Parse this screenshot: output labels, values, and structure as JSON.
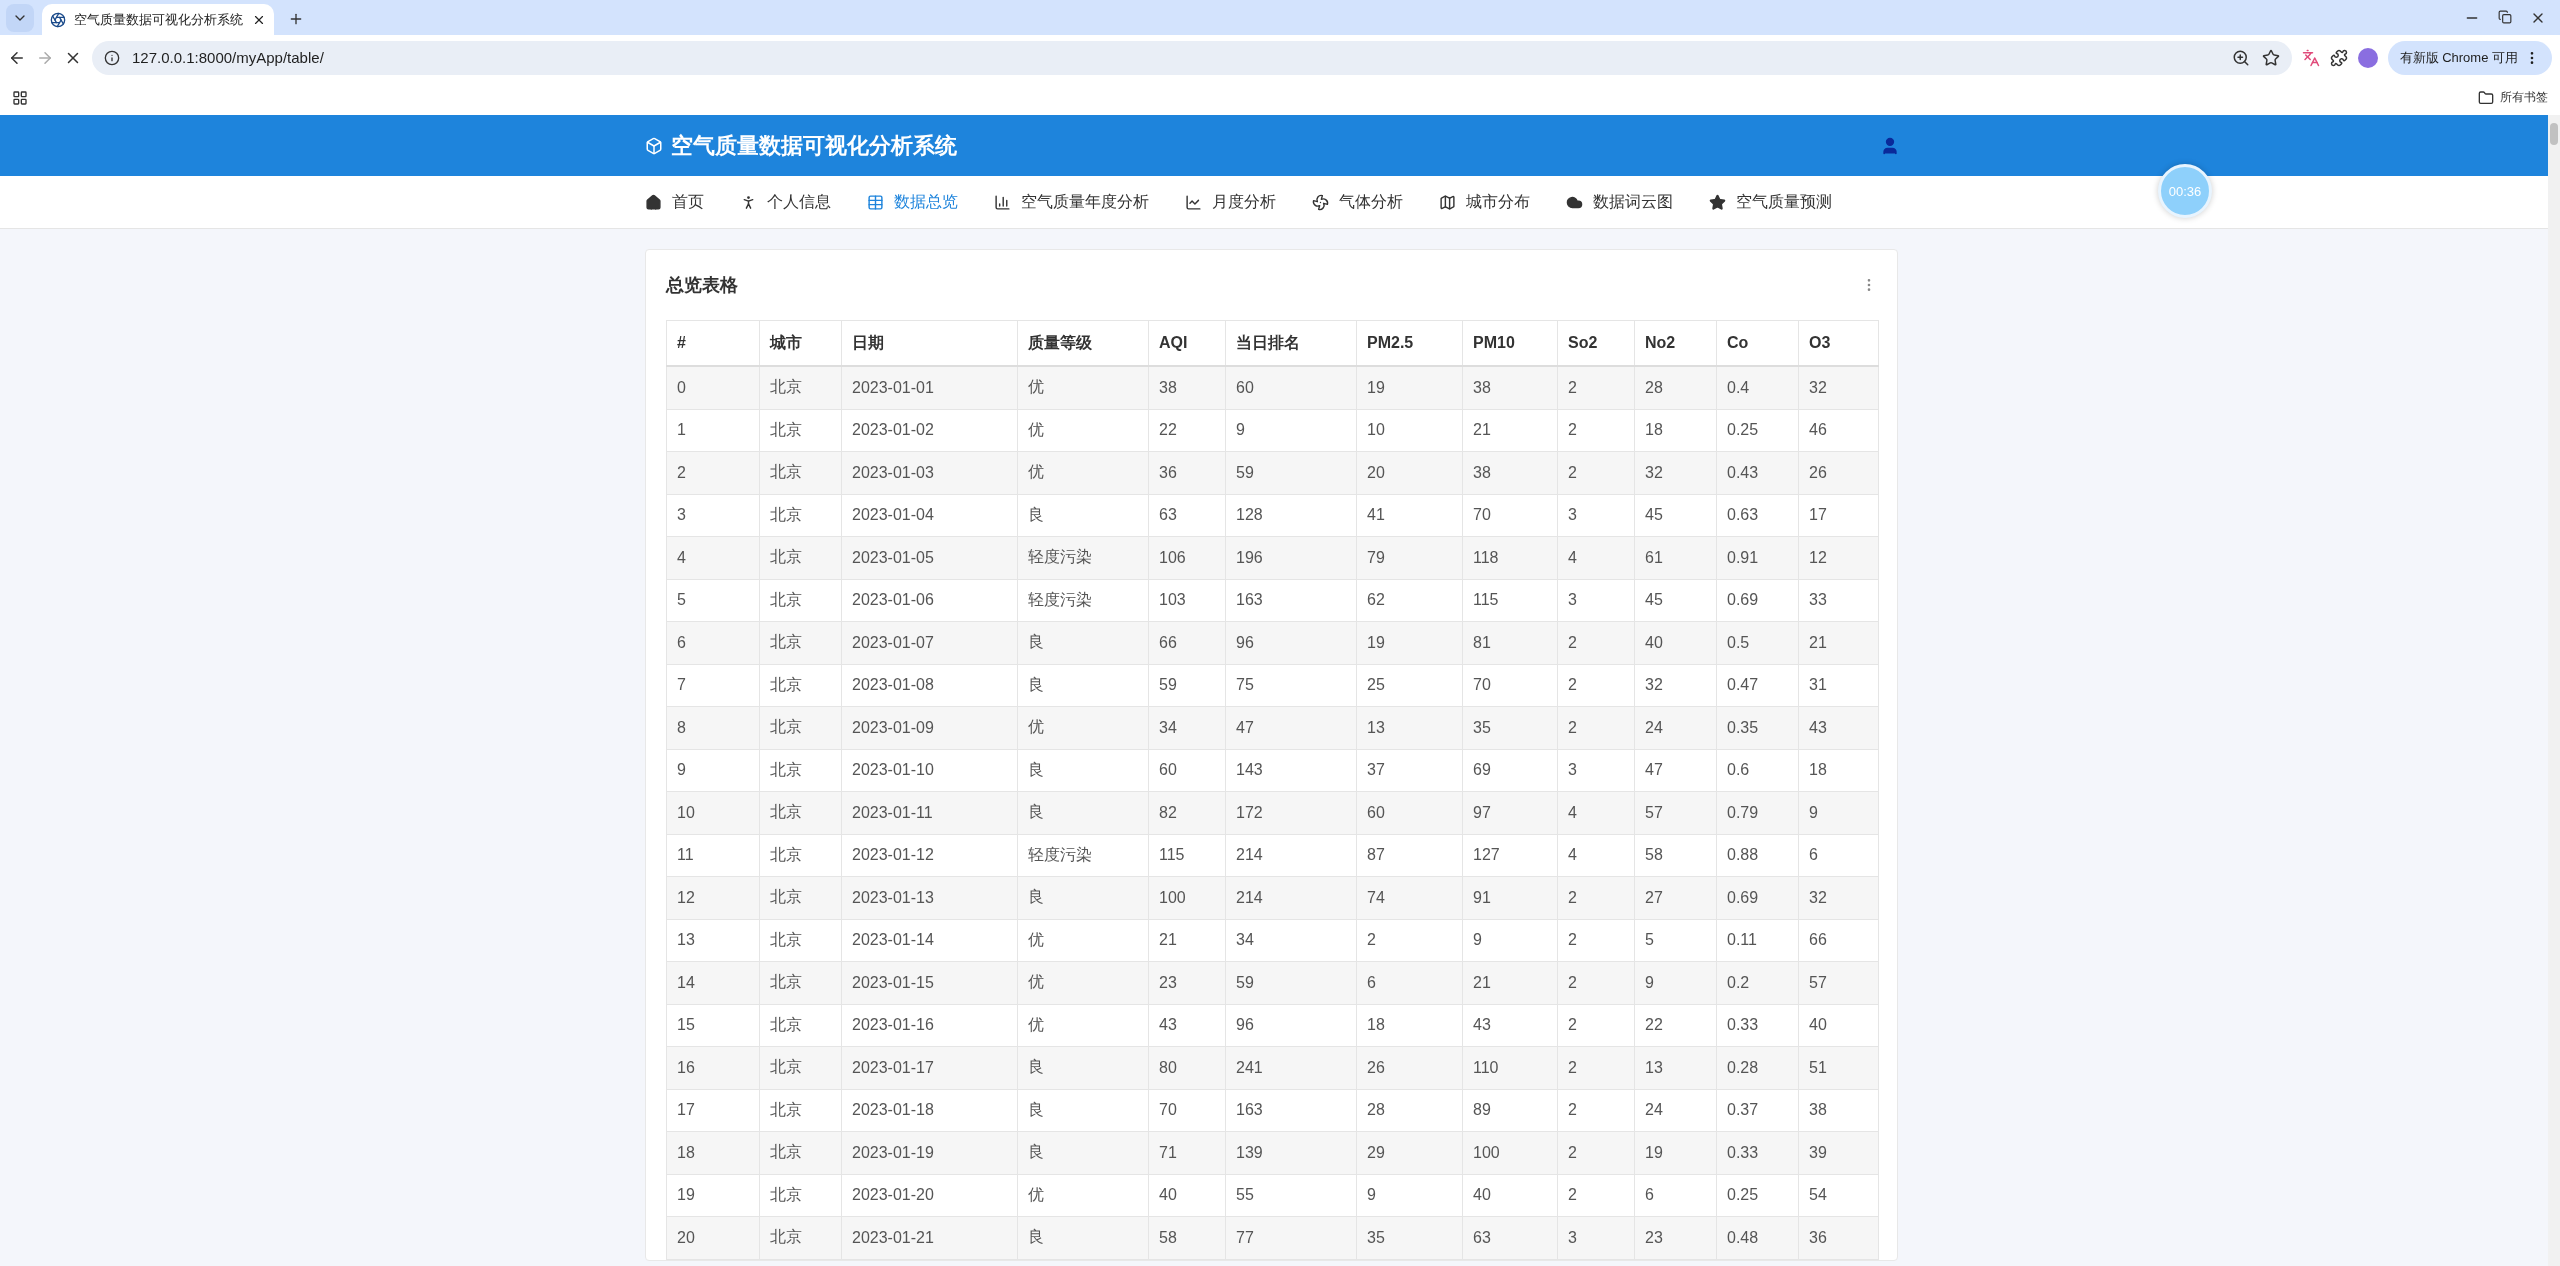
{
  "browser": {
    "tab_title": "空气质量数据可视化分析系统",
    "url": "127.0.0.1:8000/myApp/table/",
    "update_button": "有新版 Chrome 可用",
    "bookmarks_label": "所有书签"
  },
  "header": {
    "title": "空气质量数据可视化分析系统"
  },
  "nav": [
    {
      "label": "首页",
      "selected": false
    },
    {
      "label": "个人信息",
      "selected": false
    },
    {
      "label": "数据总览",
      "selected": true
    },
    {
      "label": "空气质量年度分析",
      "selected": false
    },
    {
      "label": "月度分析",
      "selected": false
    },
    {
      "label": "气体分析",
      "selected": false
    },
    {
      "label": "城市分布",
      "selected": false
    },
    {
      "label": "数据词云图",
      "selected": false
    },
    {
      "label": "空气质量预测",
      "selected": false
    }
  ],
  "timer": "00:36",
  "card": {
    "title": "总览表格"
  },
  "table": {
    "columns": [
      "#",
      "城市",
      "日期",
      "质量等级",
      "AQI",
      "当日排名",
      "PM2.5",
      "PM10",
      "So2",
      "No2",
      "Co",
      "O3"
    ],
    "rows": [
      [
        "0",
        "北京",
        "2023-01-01",
        "优",
        "38",
        "60",
        "19",
        "38",
        "2",
        "28",
        "0.4",
        "32"
      ],
      [
        "1",
        "北京",
        "2023-01-02",
        "优",
        "22",
        "9",
        "10",
        "21",
        "2",
        "18",
        "0.25",
        "46"
      ],
      [
        "2",
        "北京",
        "2023-01-03",
        "优",
        "36",
        "59",
        "20",
        "38",
        "2",
        "32",
        "0.43",
        "26"
      ],
      [
        "3",
        "北京",
        "2023-01-04",
        "良",
        "63",
        "128",
        "41",
        "70",
        "3",
        "45",
        "0.63",
        "17"
      ],
      [
        "4",
        "北京",
        "2023-01-05",
        "轻度污染",
        "106",
        "196",
        "79",
        "118",
        "4",
        "61",
        "0.91",
        "12"
      ],
      [
        "5",
        "北京",
        "2023-01-06",
        "轻度污染",
        "103",
        "163",
        "62",
        "115",
        "3",
        "45",
        "0.69",
        "33"
      ],
      [
        "6",
        "北京",
        "2023-01-07",
        "良",
        "66",
        "96",
        "19",
        "81",
        "2",
        "40",
        "0.5",
        "21"
      ],
      [
        "7",
        "北京",
        "2023-01-08",
        "良",
        "59",
        "75",
        "25",
        "70",
        "2",
        "32",
        "0.47",
        "31"
      ],
      [
        "8",
        "北京",
        "2023-01-09",
        "优",
        "34",
        "47",
        "13",
        "35",
        "2",
        "24",
        "0.35",
        "43"
      ],
      [
        "9",
        "北京",
        "2023-01-10",
        "良",
        "60",
        "143",
        "37",
        "69",
        "3",
        "47",
        "0.6",
        "18"
      ],
      [
        "10",
        "北京",
        "2023-01-11",
        "良",
        "82",
        "172",
        "60",
        "97",
        "4",
        "57",
        "0.79",
        "9"
      ],
      [
        "11",
        "北京",
        "2023-01-12",
        "轻度污染",
        "115",
        "214",
        "87",
        "127",
        "4",
        "58",
        "0.88",
        "6"
      ],
      [
        "12",
        "北京",
        "2023-01-13",
        "良",
        "100",
        "214",
        "74",
        "91",
        "2",
        "27",
        "0.69",
        "32"
      ],
      [
        "13",
        "北京",
        "2023-01-14",
        "优",
        "21",
        "34",
        "2",
        "9",
        "2",
        "5",
        "0.11",
        "66"
      ],
      [
        "14",
        "北京",
        "2023-01-15",
        "优",
        "23",
        "59",
        "6",
        "21",
        "2",
        "9",
        "0.2",
        "57"
      ],
      [
        "15",
        "北京",
        "2023-01-16",
        "优",
        "43",
        "96",
        "18",
        "43",
        "2",
        "22",
        "0.33",
        "40"
      ],
      [
        "16",
        "北京",
        "2023-01-17",
        "良",
        "80",
        "241",
        "26",
        "110",
        "2",
        "13",
        "0.28",
        "51"
      ],
      [
        "17",
        "北京",
        "2023-01-18",
        "良",
        "70",
        "163",
        "28",
        "89",
        "2",
        "24",
        "0.37",
        "38"
      ],
      [
        "18",
        "北京",
        "2023-01-19",
        "良",
        "71",
        "139",
        "29",
        "100",
        "2",
        "19",
        "0.33",
        "39"
      ],
      [
        "19",
        "北京",
        "2023-01-20",
        "优",
        "40",
        "55",
        "9",
        "40",
        "2",
        "6",
        "0.25",
        "54"
      ],
      [
        "20",
        "北京",
        "2023-01-21",
        "良",
        "58",
        "77",
        "35",
        "63",
        "3",
        "23",
        "0.48",
        "36"
      ]
    ]
  }
}
